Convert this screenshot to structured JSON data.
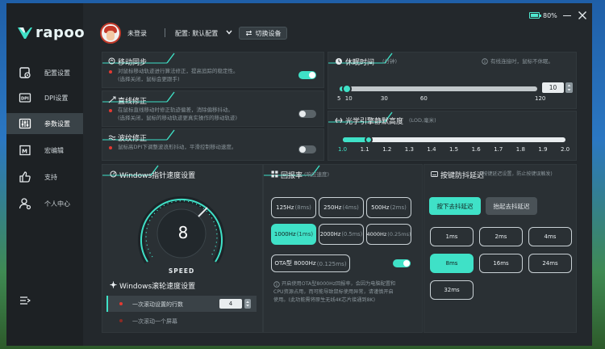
{
  "app": {
    "brand": "rapoo",
    "battery_pct": 0.8,
    "battery_label": "80%"
  },
  "sidebar": {
    "items": [
      {
        "label": "配置设置",
        "icon": "config-icon"
      },
      {
        "label": "DPI设置",
        "icon": "dpi-icon"
      },
      {
        "label": "参数设置",
        "icon": "params-icon",
        "active": true
      },
      {
        "label": "宏编辑",
        "icon": "macro-icon"
      },
      {
        "label": "支持",
        "icon": "thumbs-up-icon"
      },
      {
        "label": "个人中心",
        "icon": "user-icon"
      }
    ]
  },
  "topbar": {
    "login": "未登录",
    "profile": "配置: 默认配置",
    "switch_device": "切换设备"
  },
  "motion_sync": {
    "title": "移动同步",
    "desc1": "对鼠标移动轨迹进行算法修正，提高追踪的稳定性。",
    "desc2": "(选择关闭，鼠标会更跟手)",
    "enabled": true
  },
  "angle_snap": {
    "title": "直线修正",
    "desc1": "在鼠标直线移动时修正轨迹偏差，消除偏移抖动。",
    "desc2": "(选择关闭，鼠标的移动轨迹更真实操作的移动轨迹)",
    "enabled": false
  },
  "ripple": {
    "title": "波纹修正",
    "desc1": "鼠标高DPI下调整波浪形抖动，平滑控制移动速度。",
    "enabled": false
  },
  "sleep": {
    "title": "休眠时间",
    "unit": "(分钟)",
    "note": "有线连接时，鼠标不休眠。",
    "value": "10",
    "ticks": [
      "5",
      "10",
      "30",
      "60",
      "120"
    ],
    "fraction": 0.02
  },
  "lod": {
    "title": "光学引擎静默高度",
    "unit": "(LOD,毫米)",
    "ticks": [
      "1.0",
      "1.1",
      "1.2",
      "1.3",
      "1.4",
      "1.5",
      "1.6",
      "1.7",
      "1.8",
      "1.9",
      "2.0"
    ],
    "value": 1.1
  },
  "windows_pointer": {
    "title": "Windows指针速度设置",
    "speed_value": "8",
    "speed_label": "SPEED",
    "scroll_title": "Windows滚轮速度设置",
    "scroll_line_label": "一次滚动设置的行数",
    "scroll_line_value": "4",
    "scroll_page_label": "一次滚动一个屏幕"
  },
  "polling": {
    "title": "回报率",
    "unit": "(响应速度)",
    "options": [
      {
        "main": "125Hz",
        "sub": "(8ms)",
        "selected": false
      },
      {
        "main": "250Hz",
        "sub": "(4ms)",
        "selected": false
      },
      {
        "main": "500Hz",
        "sub": "(2ms)",
        "selected": false
      },
      {
        "main": "1000Hz",
        "sub": "(1ms)",
        "selected": true
      },
      {
        "main": "2000Hz",
        "sub": "(0.5ms)",
        "selected": false
      },
      {
        "main": "4000Hz",
        "sub": "(0.25ms)",
        "selected": false
      }
    ],
    "ota_main": "OTA型 8000Hz",
    "ota_sub": "(0.125ms)",
    "ota_enabled": true,
    "note1": "开启使用OTA型8000Hz回报率，会因为电脑配置和",
    "note2": "CPU资源占用，而可能导致鼠标使用异常，请谨慎开启",
    "note3": "使用。(此功能需将原生无线4K芯片接通到8K)"
  },
  "debounce": {
    "title": "按键防抖延迟",
    "unit": "(按键延迟设置，防止按键误触发)",
    "tab_press": "按下去抖延迟",
    "tab_release": "抬起去抖延迟",
    "options": [
      {
        "label": "1ms",
        "selected": false
      },
      {
        "label": "2ms",
        "selected": false
      },
      {
        "label": "4ms",
        "selected": false
      },
      {
        "label": "8ms",
        "selected": true
      },
      {
        "label": "16ms",
        "selected": false
      },
      {
        "label": "24ms",
        "selected": false
      },
      {
        "label": "32ms",
        "selected": false
      }
    ]
  },
  "colors": {
    "accent": "#3fe1c7",
    "panel": "#2a3034",
    "window": "#23282c",
    "sidebar": "#1d2124",
    "alert": "#e33a32"
  }
}
